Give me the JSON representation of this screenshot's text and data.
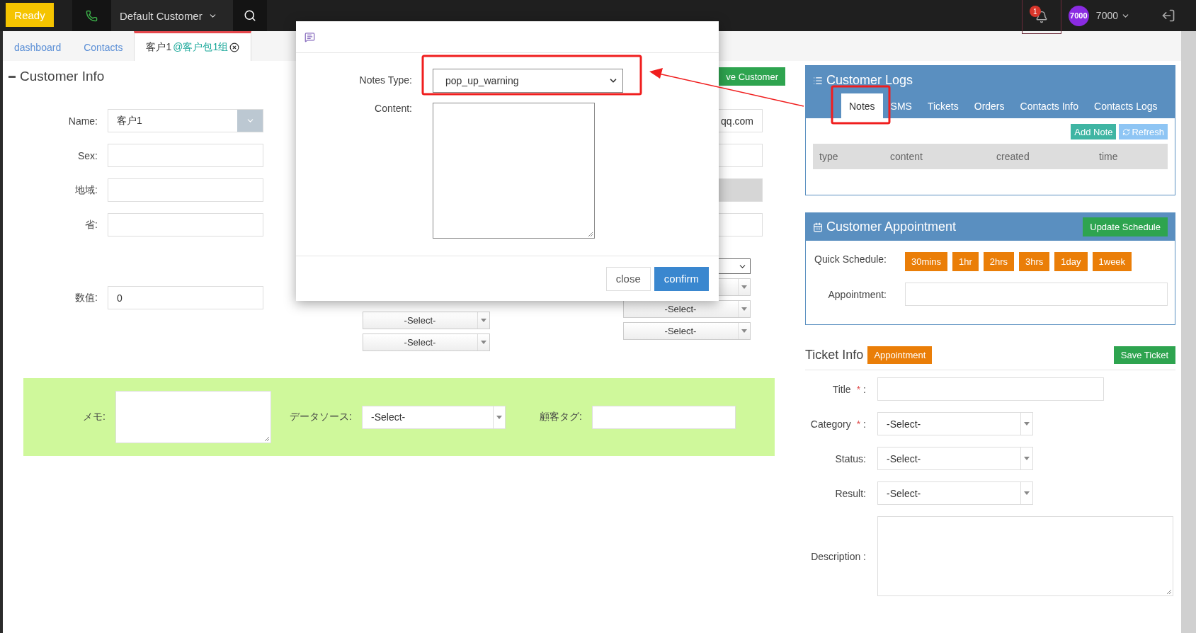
{
  "topbar": {
    "status_button": "Ready",
    "customer_selector": "Default Customer",
    "notification_count": "1",
    "avatar": "7000",
    "user_name": "7000"
  },
  "tabs": [
    {
      "label": "dashboard",
      "selected": false
    },
    {
      "label": "Contacts",
      "selected": false
    },
    {
      "label": "客户1",
      "group": "@客户包1组",
      "selected": true
    }
  ],
  "customer_info": {
    "title": "Customer Info",
    "save_button": "ve Customer",
    "fields": [
      {
        "label": "Name:",
        "kind": "combo",
        "value": "客户1"
      },
      {
        "label": "Sex:",
        "kind": "text"
      },
      {
        "label": "地域:",
        "kind": "text"
      },
      {
        "label": "省:",
        "kind": "text"
      },
      {
        "label": "数值:",
        "kind": "text",
        "value": "0"
      }
    ],
    "middle_selects": [
      {
        "value": "-Select-"
      },
      {
        "value": "-Select-"
      }
    ],
    "right_fields": [
      {
        "kind": "text",
        "value": "qq.com"
      },
      {
        "kind": "text"
      },
      {
        "kind": "disabled"
      },
      {
        "kind": "text"
      },
      {
        "kind": "native_select"
      },
      {
        "kind": "select"
      },
      {
        "kind": "select",
        "value": "-Select-"
      },
      {
        "kind": "select",
        "value": "-Select-"
      }
    ]
  },
  "memo_band": {
    "memo_label": "メモ:",
    "source_label": "データソース:",
    "source_value": "-Select-",
    "tag_label": "顧客タグ:"
  },
  "modal": {
    "notes_type_label": "Notes Type:",
    "notes_type_value": "pop_up_warning",
    "content_label": "Content:",
    "buttons": [
      {
        "label": "close",
        "kind": "default"
      },
      {
        "label": "confirm",
        "kind": "primary"
      }
    ]
  },
  "customer_logs": {
    "title": "Customer Logs",
    "tabs": [
      {
        "label": "Notes",
        "selected": true
      },
      {
        "label": "SMS",
        "selected": false
      },
      {
        "label": "Tickets",
        "selected": false
      },
      {
        "label": "Orders",
        "selected": false
      },
      {
        "label": "Contacts Info",
        "selected": false
      },
      {
        "label": "Contacts Logs",
        "selected": false
      }
    ],
    "actions": [
      {
        "label": "Add Note",
        "kind": "add"
      },
      {
        "label": "Refresh",
        "kind": "refresh"
      }
    ],
    "columns": [
      "type",
      "content",
      "created",
      "time"
    ]
  },
  "appointment": {
    "title": "Customer Appointment",
    "update_button": "Update Schedule",
    "quick_label": "Quick Schedule:",
    "quick_buttons": [
      "30mins",
      "1hr",
      "2hrs",
      "3hrs",
      "1day",
      "1week"
    ],
    "appointment_label": "Appointment:"
  },
  "ticket": {
    "title": "Ticket Info",
    "appointment_button": "Appointment",
    "save_button": "Save Ticket",
    "fields": [
      {
        "label": "Title",
        "required_mark": "*",
        "colon": ":",
        "kind": "text"
      },
      {
        "label": "Category",
        "required_mark": "*",
        "colon": ":",
        "kind": "select",
        "value": "-Select-"
      },
      {
        "label": "Status:",
        "kind": "select",
        "value": "-Select-"
      },
      {
        "label": "Result:",
        "kind": "select",
        "value": "-Select-"
      },
      {
        "label": "Description :",
        "kind": "textarea"
      }
    ]
  }
}
